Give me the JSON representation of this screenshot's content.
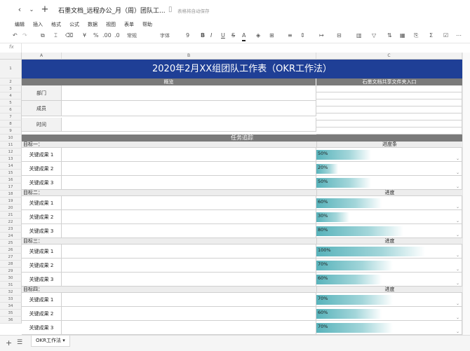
{
  "topbar": {
    "back_icon": "chevron-left-icon",
    "forward_icon": "chevron-right-icon",
    "new_icon": "plus-icon",
    "title": "石墨文档_远程办公_月（周）团队工...",
    "save_status": "表格将自动保存"
  },
  "menu": [
    "编辑",
    "插入",
    "格式",
    "公式",
    "数据",
    "视图",
    "表单",
    "帮助"
  ],
  "toolbar": {
    "currency": "¥",
    "percent": "%",
    "decimal": ".00",
    "decimal_up": ".0",
    "format": "常规",
    "font": "字体",
    "font_size": "9",
    "bold": "B",
    "italic": "I",
    "underline": "U",
    "strike": "S",
    "font_color": "A",
    "sum": "Σ"
  },
  "formula_bar": {
    "fx_label": "fx",
    "value": ""
  },
  "columns": [
    "A",
    "B",
    "C"
  ],
  "rows": [
    "1",
    "2",
    "3",
    "4",
    "5",
    "6",
    "7",
    "8",
    "9",
    "10",
    "11",
    "12",
    "13",
    "14",
    "15",
    "16",
    "17",
    "18",
    "19",
    "20",
    "21",
    "22",
    "23",
    "24",
    "25",
    "26",
    "27",
    "28",
    "29",
    "30",
    "31",
    "32",
    "33",
    "34",
    "35",
    "36"
  ],
  "sheet": {
    "title": "2020年2月XX组团队工作表（OKR工作法）",
    "overview_header": "概览",
    "link_header": "石墨文档共享文件夹入口",
    "info_labels": [
      "部门",
      "成员",
      "时间"
    ],
    "task_header": "任务追踪",
    "goals": [
      {
        "name": "目标一：",
        "progress_label": "进度条",
        "krs": [
          {
            "label": "关键成果 1",
            "progress": "50%",
            "value": 0.5
          },
          {
            "label": "关键成果 2",
            "progress": "20%",
            "value": 0.2
          },
          {
            "label": "关键成果 3",
            "progress": "50%",
            "value": 0.5
          }
        ]
      },
      {
        "name": "目标二：",
        "progress_label": "进度",
        "krs": [
          {
            "label": "关键成果 1",
            "progress": "60%",
            "value": 0.6
          },
          {
            "label": "关键成果 2",
            "progress": "30%",
            "value": 0.3
          },
          {
            "label": "关键成果 3",
            "progress": "80%",
            "value": 0.8
          }
        ]
      },
      {
        "name": "目标三：",
        "progress_label": "进度",
        "krs": [
          {
            "label": "关键成果 1",
            "progress": "100%",
            "value": 1.0
          },
          {
            "label": "关键成果 2",
            "progress": "70%",
            "value": 0.7
          },
          {
            "label": "关键成果 3",
            "progress": "60%",
            "value": 0.6
          }
        ]
      },
      {
        "name": "目标四：",
        "progress_label": "进度",
        "krs": [
          {
            "label": "关键成果 1",
            "progress": "70%",
            "value": 0.7
          },
          {
            "label": "关键成果 2",
            "progress": "60%",
            "value": 0.6
          },
          {
            "label": "关键成果 3",
            "progress": "70%",
            "value": 0.7
          }
        ]
      }
    ]
  },
  "tabs": {
    "add_icon": "plus-icon",
    "list_icon": "list-icon",
    "active": "OKR工作法",
    "dropdown_icon": "caret-down-icon"
  }
}
